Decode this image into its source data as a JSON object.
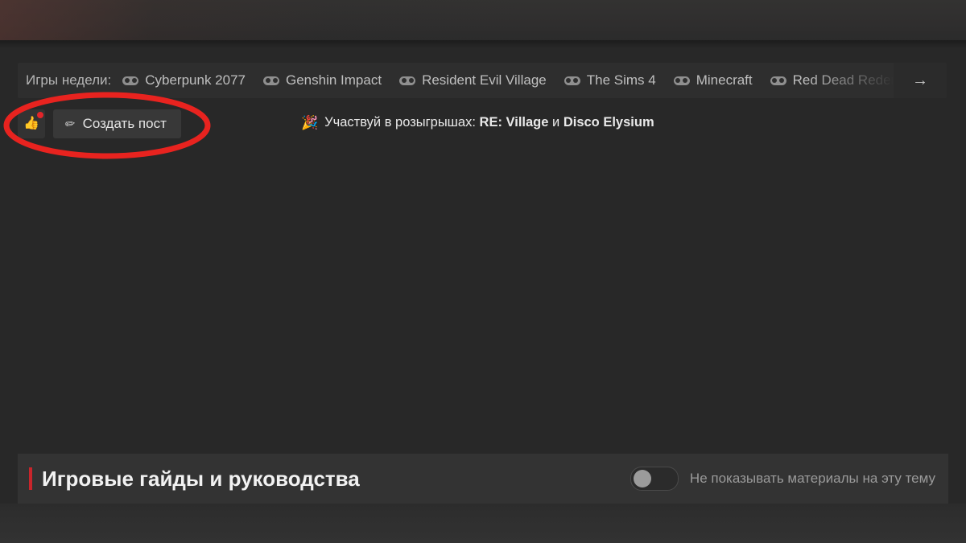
{
  "games_bar": {
    "label": "Игры недели:",
    "items": [
      {
        "name": "Cyberpunk 2077",
        "icon": "gamepad-icon"
      },
      {
        "name": "Genshin Impact",
        "icon": "gamepad-icon"
      },
      {
        "name": "Resident Evil Village",
        "icon": "gamepad-icon"
      },
      {
        "name": "The Sims 4",
        "icon": "gamepad-icon"
      },
      {
        "name": "Minecraft",
        "icon": "gamepad-icon"
      },
      {
        "name": "Red Dead Redemption",
        "icon": "gamepad-icon"
      }
    ],
    "next_arrow": "→"
  },
  "actions": {
    "like_icon": "👍",
    "like_badge": "",
    "create_post_icon": "✏",
    "create_post_label": "Создать пост"
  },
  "giveaway": {
    "emoji": "🎉",
    "prefix": "Участвуй в розыгрышах: ",
    "bold_first": "RE: Village",
    "conjunction": " и ",
    "bold_second": "Disco Elysium"
  },
  "section": {
    "title": "Игровые гайды и руководства",
    "toggle_state": "off",
    "toggle_label": "Не показывать материалы на эту тему"
  },
  "colors": {
    "page_background": "#282828",
    "bar_background": "#2e2e2e",
    "section_background": "#333333",
    "accent_red": "#c9252b",
    "badge_red": "#e2252a",
    "annotation_red": "#e8231f",
    "text_primary": "#e9e9e9",
    "text_muted": "#9a9a9a"
  }
}
